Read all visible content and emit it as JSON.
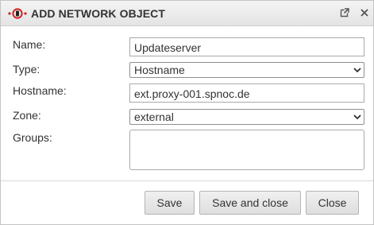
{
  "window": {
    "title": "ADD NETWORK OBJECT",
    "popout_icon": "popout-icon",
    "close_icon": "close-icon",
    "app_icon": "securepoint-logo-icon",
    "brand_color": "#d42020"
  },
  "form": {
    "name": {
      "label": "Name:",
      "value": "Updateserver"
    },
    "type": {
      "label": "Type:",
      "value": "Hostname"
    },
    "hostname": {
      "label": "Hostname:",
      "value": "ext.proxy-001.spnoc.de"
    },
    "zone": {
      "label": "Zone:",
      "value": "external"
    },
    "groups": {
      "label": "Groups:",
      "value": ""
    }
  },
  "footer": {
    "save_label": "Save",
    "save_close_label": "Save and close",
    "close_label": "Close"
  }
}
